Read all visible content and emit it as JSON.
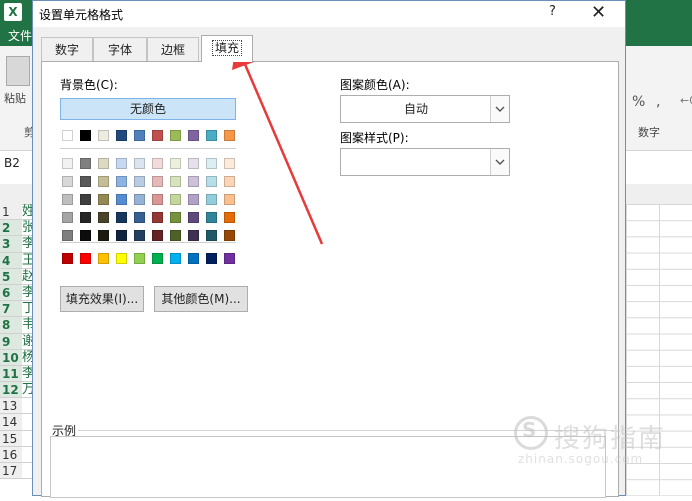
{
  "excel": {
    "logo": "X",
    "menu_file": "文件",
    "paste_label": "粘贴",
    "clipboard_label": "剪",
    "percent_symbol": "%",
    "comma_symbol": ",",
    "decimal_symbol": "←0",
    "number_group_label": "数字",
    "name_box": "B2",
    "rows": [
      "1",
      "2",
      "3",
      "4",
      "5",
      "6",
      "7",
      "8",
      "9",
      "10",
      "11",
      "12",
      "13",
      "14",
      "15",
      "16",
      "17"
    ],
    "col_a_cells": [
      "姓",
      "张",
      "李",
      "王",
      "赵",
      "李",
      "丁",
      "韦",
      "谢",
      "杨",
      "李",
      "万",
      "",
      "",
      "",
      "",
      ""
    ],
    "accent_color": "#217346"
  },
  "dialog": {
    "title": "设置单元格格式",
    "help_label": "?",
    "close_label": "✕",
    "tabs": [
      {
        "label": "数字"
      },
      {
        "label": "字体"
      },
      {
        "label": "边框"
      },
      {
        "label": "填充",
        "active": true
      }
    ],
    "fill": {
      "bg_label": "背景色(C):",
      "no_color_label": "无颜色",
      "theme_row": [
        "#ffffff",
        "#000000",
        "#e7e6e6",
        "#44546a",
        "#4472c4",
        "#ed7d31",
        "#a5a5a5",
        "#ffc000",
        "#5b9bd5",
        "#70ad47"
      ],
      "theme_colors_top": [
        "#ffffff",
        "#000000",
        "#eeece1",
        "#1f497d",
        "#4f81bd",
        "#c0504d",
        "#9bbb59",
        "#8064a2",
        "#4bacc6",
        "#f79646"
      ],
      "tint_rows": [
        [
          "#f2f2f2",
          "#7f7f7f",
          "#ddd9c3",
          "#c6d9f0",
          "#dbe5f1",
          "#f2dcdb",
          "#ebf1dd",
          "#e5e0ec",
          "#dbeef3",
          "#fdeada"
        ],
        [
          "#d8d8d8",
          "#595959",
          "#c4bd97",
          "#8db3e2",
          "#b8cce4",
          "#e5b9b7",
          "#d7e3bc",
          "#ccc1d9",
          "#b7dde8",
          "#fbd5b5"
        ],
        [
          "#bfbfbf",
          "#3f3f3f",
          "#938953",
          "#548dd4",
          "#95b3d7",
          "#d99694",
          "#c3d69b",
          "#b2a2c7",
          "#92cddc",
          "#fac08f"
        ],
        [
          "#a5a5a5",
          "#262626",
          "#494429",
          "#17365d",
          "#366092",
          "#953734",
          "#76923c",
          "#5f497a",
          "#31859b",
          "#e36c09"
        ],
        [
          "#7f7f7f",
          "#0c0c0c",
          "#1d1b10",
          "#0f243e",
          "#244061",
          "#632423",
          "#4f6128",
          "#3f3151",
          "#205867",
          "#974806"
        ]
      ],
      "standard_colors": [
        "#c00000",
        "#ff0000",
        "#ffc000",
        "#ffff00",
        "#92d050",
        "#00b050",
        "#00b0f0",
        "#0070c0",
        "#002060",
        "#7030a0"
      ],
      "fill_effects_label": "填充效果(I)...",
      "more_colors_label": "其他颜色(M)...",
      "pattern_color_label": "图案颜色(A):",
      "pattern_color_value": "自动",
      "pattern_style_label": "图案样式(P):",
      "pattern_style_value": "",
      "sample_label": "示例"
    },
    "annotation_arrow_color": "#e83a3a"
  },
  "watermark": {
    "icon_letter": "S",
    "text": "搜狗指南",
    "url": "zhinan.sogou.com"
  }
}
